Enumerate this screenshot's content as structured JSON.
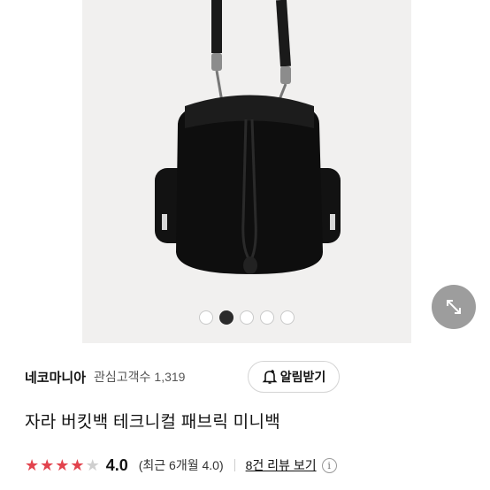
{
  "gallery": {
    "slide_count": 5,
    "active_index": 1,
    "image_alt": "bucket-bag-product-photo"
  },
  "expand_button": {
    "icon": "expand-arrows-icon"
  },
  "seller": {
    "name": "네코마니아",
    "follower_label": "관심고객수",
    "follower_count": "1,319",
    "alarm_button_label": "알림받기",
    "alarm_icon": "bell-plus-icon"
  },
  "product": {
    "title": "자라 버킷백 테크니컬 패브릭 미니백"
  },
  "rating": {
    "score": "4.0",
    "stars_filled": 4,
    "stars_total": 5,
    "recent_text": "(최근 6개월 4.0)",
    "review_link": "8건 리뷰 보기",
    "info_icon": "info-icon",
    "star_color": "#e2434d"
  }
}
